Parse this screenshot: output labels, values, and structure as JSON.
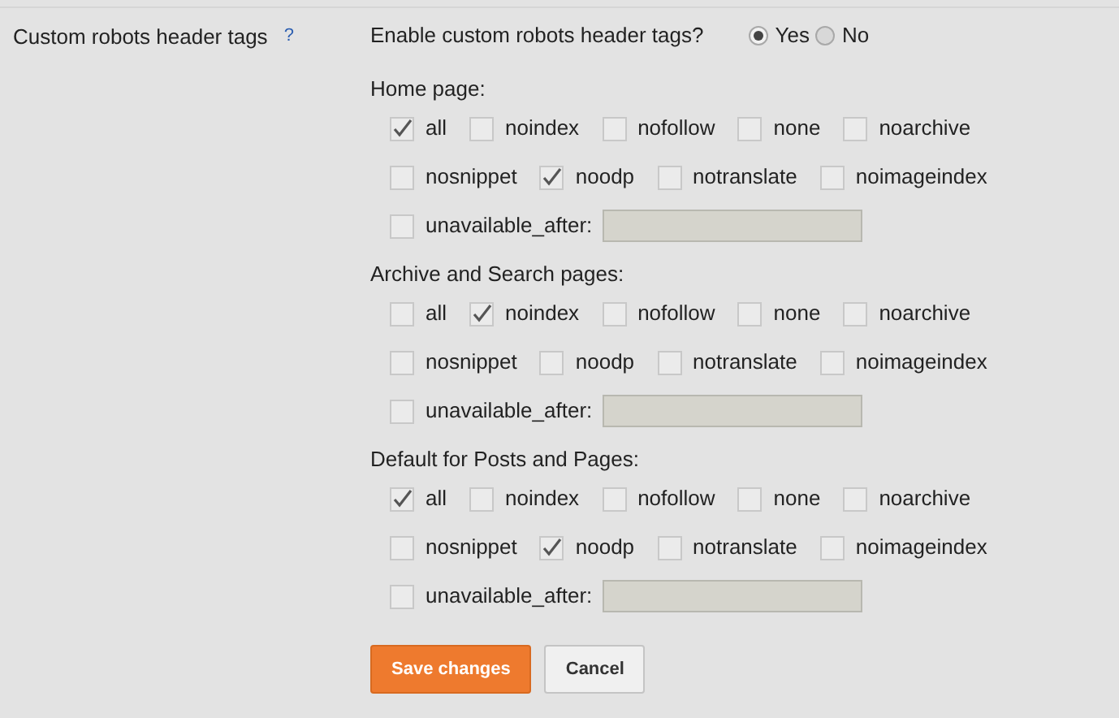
{
  "setting": {
    "label": "Custom robots header tags",
    "help": "?"
  },
  "enable": {
    "question": "Enable custom robots header tags?",
    "options": [
      {
        "label": "Yes",
        "selected": true
      },
      {
        "label": "No",
        "selected": false
      }
    ]
  },
  "sections": [
    {
      "title": "Home page:",
      "lines": [
        {
          "options": [
            {
              "label": "all",
              "checked": true
            },
            {
              "label": "noindex",
              "checked": false
            },
            {
              "label": "nofollow",
              "checked": false
            },
            {
              "label": "none",
              "checked": false
            },
            {
              "label": "noarchive",
              "checked": false
            }
          ]
        },
        {
          "options": [
            {
              "label": "nosnippet",
              "checked": false
            },
            {
              "label": "noodp",
              "checked": true
            },
            {
              "label": "notranslate",
              "checked": false
            },
            {
              "label": "noimageindex",
              "checked": false
            }
          ]
        }
      ],
      "date": {
        "label": "unavailable_after:",
        "checked": false
      }
    },
    {
      "title": "Archive and Search pages:",
      "lines": [
        {
          "options": [
            {
              "label": "all",
              "checked": false
            },
            {
              "label": "noindex",
              "checked": true
            },
            {
              "label": "nofollow",
              "checked": false
            },
            {
              "label": "none",
              "checked": false
            },
            {
              "label": "noarchive",
              "checked": false
            }
          ]
        },
        {
          "options": [
            {
              "label": "nosnippet",
              "checked": false
            },
            {
              "label": "noodp",
              "checked": false
            },
            {
              "label": "notranslate",
              "checked": false
            },
            {
              "label": "noimageindex",
              "checked": false
            }
          ]
        }
      ],
      "date": {
        "label": "unavailable_after:",
        "checked": false
      }
    },
    {
      "title": "Default for Posts and Pages:",
      "lines": [
        {
          "options": [
            {
              "label": "all",
              "checked": true
            },
            {
              "label": "noindex",
              "checked": false
            },
            {
              "label": "nofollow",
              "checked": false
            },
            {
              "label": "none",
              "checked": false
            },
            {
              "label": "noarchive",
              "checked": false
            }
          ]
        },
        {
          "options": [
            {
              "label": "nosnippet",
              "checked": false
            },
            {
              "label": "noodp",
              "checked": true
            },
            {
              "label": "notranslate",
              "checked": false
            },
            {
              "label": "noimageindex",
              "checked": false
            }
          ]
        }
      ],
      "date": {
        "label": "unavailable_after:",
        "checked": false
      }
    }
  ],
  "buttons": [
    {
      "label": "Save changes",
      "kind": "primary"
    },
    {
      "label": "Cancel",
      "kind": "secondary"
    }
  ]
}
